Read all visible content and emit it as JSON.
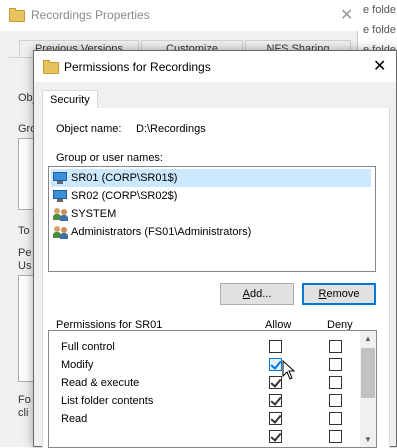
{
  "background_window": {
    "title": "Recordings Properties",
    "tabs": [
      "Previous Versions",
      "Customize",
      "NFS Sharing"
    ],
    "clipped_labels": [
      "Obj",
      "Gro",
      "To",
      "Pe",
      "Us",
      "Fo",
      "cli"
    ]
  },
  "right_strip": {
    "lines": [
      "e folde",
      "e folde",
      "e folde"
    ]
  },
  "dialog": {
    "title": "Permissions for Recordings",
    "tab": "Security",
    "object_name_label": "Object name:",
    "object_name_value": "D:\\Recordings",
    "groups_label": "Group or user names:",
    "groups": [
      {
        "name": "SR01 (CORP\\SR01$)",
        "icon": "computer-icon",
        "selected": true
      },
      {
        "name": "SR02 (CORP\\SR02$)",
        "icon": "computer-icon",
        "selected": false
      },
      {
        "name": "SYSTEM",
        "icon": "users-icon",
        "selected": false
      },
      {
        "name": "Administrators (FS01\\Administrators)",
        "icon": "users-icon",
        "selected": false
      }
    ],
    "add_button": "Add...",
    "remove_button": "Remove",
    "permissions_label": "Permissions for SR01",
    "allow_header": "Allow",
    "deny_header": "Deny",
    "permissions": [
      {
        "name": "Full control",
        "allow": false,
        "deny": false
      },
      {
        "name": "Modify",
        "allow": true,
        "deny": false
      },
      {
        "name": "Read & execute",
        "allow": true,
        "deny": false
      },
      {
        "name": "List folder contents",
        "allow": true,
        "deny": false
      },
      {
        "name": "Read",
        "allow": true,
        "deny": false
      }
    ]
  },
  "colors": {
    "selection": "#cce8ff",
    "accent": "#0078d7"
  }
}
